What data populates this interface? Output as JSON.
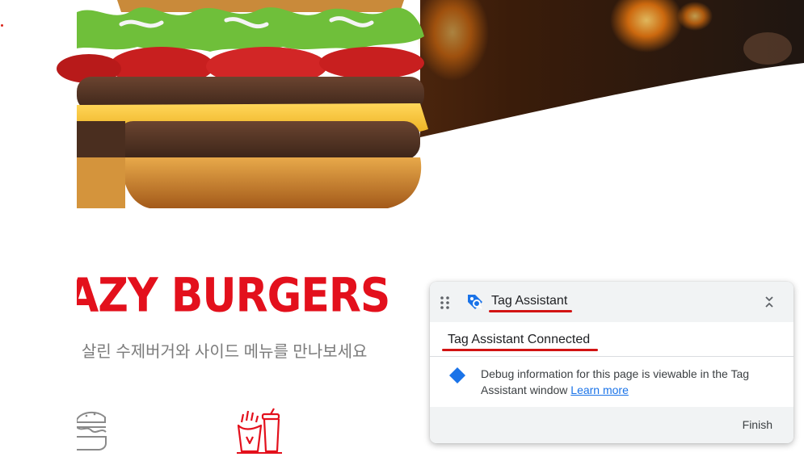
{
  "brand": {
    "title": "RAZY BURGERS",
    "tagline": "살린 수제버거와 사이드 메뉴를 만나보세요"
  },
  "menu_icons": [
    "burger-icon",
    "fries-drink-icon"
  ],
  "tag_assistant": {
    "title": "Tag Assistant",
    "status": "Tag Assistant Connected",
    "message": "Debug information for this page is viewable in the Tag Assistant window",
    "learn_more": "Learn more",
    "finish_label": "Finish"
  },
  "colors": {
    "brand_red": "#e3101c",
    "tag_assistant_blue": "#1a73e8",
    "annotation_red": "#d21313"
  }
}
